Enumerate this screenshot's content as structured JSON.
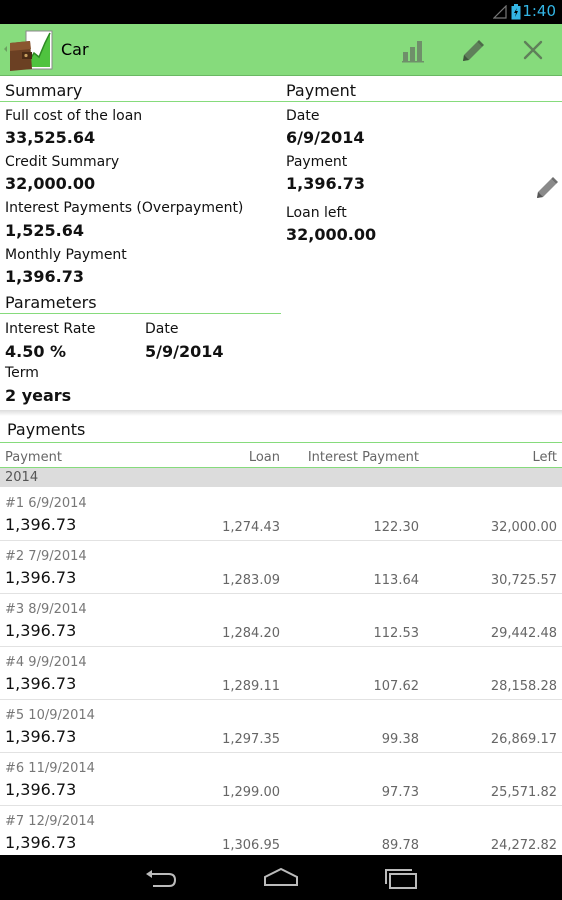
{
  "status": {
    "time": "1:40"
  },
  "action_bar": {
    "title": "Car"
  },
  "summary": {
    "heading": "Summary",
    "full_cost_label": "Full cost of the loan",
    "full_cost_value": "33,525.64",
    "credit_label": "Credit Summary",
    "credit_value": "32,000.00",
    "interest_label": "Interest Payments (Overpayment)",
    "interest_value": "1,525.64",
    "monthly_label": "Monthly Payment",
    "monthly_value": "1,396.73"
  },
  "parameters": {
    "heading": "Parameters",
    "rate_label": "Interest Rate",
    "rate_value": "4.50 %",
    "date_label": "Date",
    "date_value": "5/9/2014",
    "term_label": "Term",
    "term_value": "2 years"
  },
  "payment": {
    "heading": "Payment",
    "date_label": "Date",
    "date_value": "6/9/2014",
    "payment_label": "Payment",
    "payment_value": "1,396.73",
    "loan_left_label": "Loan left",
    "loan_left_value": "32,000.00"
  },
  "payments": {
    "heading": "Payments",
    "columns": [
      "Payment",
      "Loan",
      "Interest Payment",
      "Left"
    ],
    "year": "2014",
    "rows": [
      {
        "label": "#1 6/9/2014",
        "payment": "1,396.73",
        "loan": "1,274.43",
        "interest": "122.30",
        "left": "32,000.00"
      },
      {
        "label": "#2 7/9/2014",
        "payment": "1,396.73",
        "loan": "1,283.09",
        "interest": "113.64",
        "left": "30,725.57"
      },
      {
        "label": "#3 8/9/2014",
        "payment": "1,396.73",
        "loan": "1,284.20",
        "interest": "112.53",
        "left": "29,442.48"
      },
      {
        "label": "#4 9/9/2014",
        "payment": "1,396.73",
        "loan": "1,289.11",
        "interest": "107.62",
        "left": "28,158.28"
      },
      {
        "label": "#5 10/9/2014",
        "payment": "1,396.73",
        "loan": "1,297.35",
        "interest": "99.38",
        "left": "26,869.17"
      },
      {
        "label": "#6 11/9/2014",
        "payment": "1,396.73",
        "loan": "1,299.00",
        "interest": "97.73",
        "left": "25,571.82"
      },
      {
        "label": "#7 12/9/2014",
        "payment": "1,396.73",
        "loan": "1,306.95",
        "interest": "89.78",
        "left": "24,272.82"
      }
    ]
  },
  "icons": {
    "action_bar": [
      "chart-icon",
      "pencil-icon",
      "close-icon"
    ],
    "nav": [
      "back-icon",
      "home-icon",
      "recent-apps-icon"
    ]
  },
  "colors": {
    "accent": "#86db7c",
    "clock": "#33b5e5"
  }
}
